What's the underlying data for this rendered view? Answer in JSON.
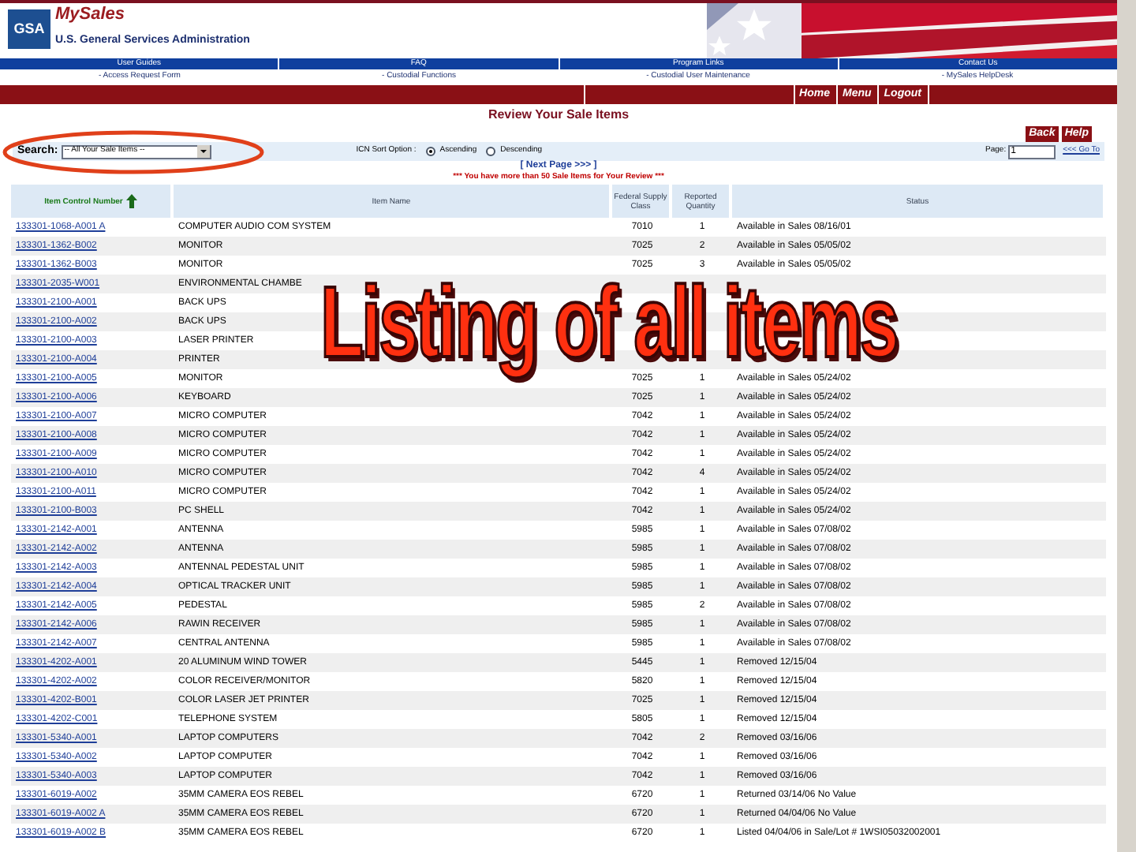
{
  "header": {
    "logo": "GSA",
    "title": "MySales",
    "subtitle": "U.S. General Services Administration"
  },
  "nav_top": [
    "User Guides",
    "FAQ",
    "Program Links",
    "Contact Us"
  ],
  "nav_links": [
    "- Access Request Form",
    "- Custodial Functions",
    "- Custodial User Maintenance",
    "- MySales HelpDesk"
  ],
  "menu_buttons": [
    "Home",
    "Menu",
    "Logout"
  ],
  "page_title": "Review Your Sale Items",
  "action_buttons": [
    "Back",
    "Help"
  ],
  "search": {
    "label": "Search:",
    "value": "-- All Your Sale Items --"
  },
  "sort": {
    "label": "ICN Sort Option :",
    "options": [
      {
        "label": "Ascending",
        "selected": true
      },
      {
        "label": "Descending",
        "selected": false
      }
    ]
  },
  "pager": {
    "label": "Page:",
    "value": "1",
    "go": "<<< Go To",
    "next": "[ Next Page >>> ]"
  },
  "notice": "*** You have more than 50 Sale Items for Your Review ***",
  "table": {
    "columns": [
      "Item Control Number",
      "Item Name",
      "Federal Supply Class",
      "Reported Quantity",
      "Status"
    ],
    "rows": [
      [
        "133301-1068-A001 A",
        "COMPUTER AUDIO COM SYSTEM",
        "7010",
        "1",
        "Available in Sales 08/16/01"
      ],
      [
        "133301-1362-B002",
        "MONITOR",
        "7025",
        "2",
        "Available in Sales 05/05/02"
      ],
      [
        "133301-1362-B003",
        "MONITOR",
        "7025",
        "3",
        "Available in Sales 05/05/02"
      ],
      [
        "133301-2035-W001",
        "ENVIRONMENTAL CHAMBE"
      ],
      [
        "133301-2100-A001",
        "BACK UPS"
      ],
      [
        "133301-2100-A002",
        "BACK UPS"
      ],
      [
        "133301-2100-A003",
        "LASER PRINTER"
      ],
      [
        "133301-2100-A004",
        "PRINTER"
      ],
      [
        "133301-2100-A005",
        "MONITOR",
        "7025",
        "1",
        "Available in Sales 05/24/02"
      ],
      [
        "133301-2100-A006",
        "KEYBOARD",
        "7025",
        "1",
        "Available in Sales 05/24/02"
      ],
      [
        "133301-2100-A007",
        "MICRO COMPUTER",
        "7042",
        "1",
        "Available in Sales 05/24/02"
      ],
      [
        "133301-2100-A008",
        "MICRO COMPUTER",
        "7042",
        "1",
        "Available in Sales 05/24/02"
      ],
      [
        "133301-2100-A009",
        "MICRO COMPUTER",
        "7042",
        "1",
        "Available in Sales 05/24/02"
      ],
      [
        "133301-2100-A010",
        "MICRO COMPUTER",
        "7042",
        "4",
        "Available in Sales 05/24/02"
      ],
      [
        "133301-2100-A011",
        "MICRO COMPUTER",
        "7042",
        "1",
        "Available in Sales 05/24/02"
      ],
      [
        "133301-2100-B003",
        "PC SHELL",
        "7042",
        "1",
        "Available in Sales 05/24/02"
      ],
      [
        "133301-2142-A001",
        "ANTENNA",
        "5985",
        "1",
        "Available in Sales 07/08/02"
      ],
      [
        "133301-2142-A002",
        "ANTENNA",
        "5985",
        "1",
        "Available in Sales 07/08/02"
      ],
      [
        "133301-2142-A003",
        "ANTENNAL PEDESTAL UNIT",
        "5985",
        "1",
        "Available in Sales 07/08/02"
      ],
      [
        "133301-2142-A004",
        "OPTICAL TRACKER UNIT",
        "5985",
        "1",
        "Available in Sales 07/08/02"
      ],
      [
        "133301-2142-A005",
        "PEDESTAL",
        "5985",
        "2",
        "Available in Sales 07/08/02"
      ],
      [
        "133301-2142-A006",
        "RAWIN RECEIVER",
        "5985",
        "1",
        "Available in Sales 07/08/02"
      ],
      [
        "133301-2142-A007",
        "CENTRAL ANTENNA",
        "5985",
        "1",
        "Available in Sales 07/08/02"
      ],
      [
        "133301-4202-A001",
        "20 ALUMINUM WIND TOWER",
        "5445",
        "1",
        "Removed 12/15/04"
      ],
      [
        "133301-4202-A002",
        "COLOR RECEIVER/MONITOR",
        "5820",
        "1",
        "Removed 12/15/04"
      ],
      [
        "133301-4202-B001",
        "COLOR LASER JET PRINTER",
        "7025",
        "1",
        "Removed 12/15/04"
      ],
      [
        "133301-4202-C001",
        "TELEPHONE SYSTEM",
        "5805",
        "1",
        "Removed 12/15/04"
      ],
      [
        "133301-5340-A001",
        "LAPTOP COMPUTERS",
        "7042",
        "2",
        "Removed 03/16/06"
      ],
      [
        "133301-5340-A002",
        "LAPTOP COMPUTER",
        "7042",
        "1",
        "Removed 03/16/06"
      ],
      [
        "133301-5340-A003",
        "LAPTOP COMPUTER",
        "7042",
        "1",
        "Removed 03/16/06"
      ],
      [
        "133301-6019-A002",
        "35MM CAMERA EOS REBEL",
        "6720",
        "1",
        "Returned 03/14/06 No Value"
      ],
      [
        "133301-6019-A002 A",
        "35MM CAMERA EOS REBEL",
        "6720",
        "1",
        "Returned 04/04/06 No Value"
      ],
      [
        "133301-6019-A002 B",
        "35MM CAMERA EOS REBEL",
        "6720",
        "1",
        "Listed 04/04/06 in Sale/Lot # 1WSI05032002001"
      ]
    ]
  },
  "caption": "Listing of all items"
}
